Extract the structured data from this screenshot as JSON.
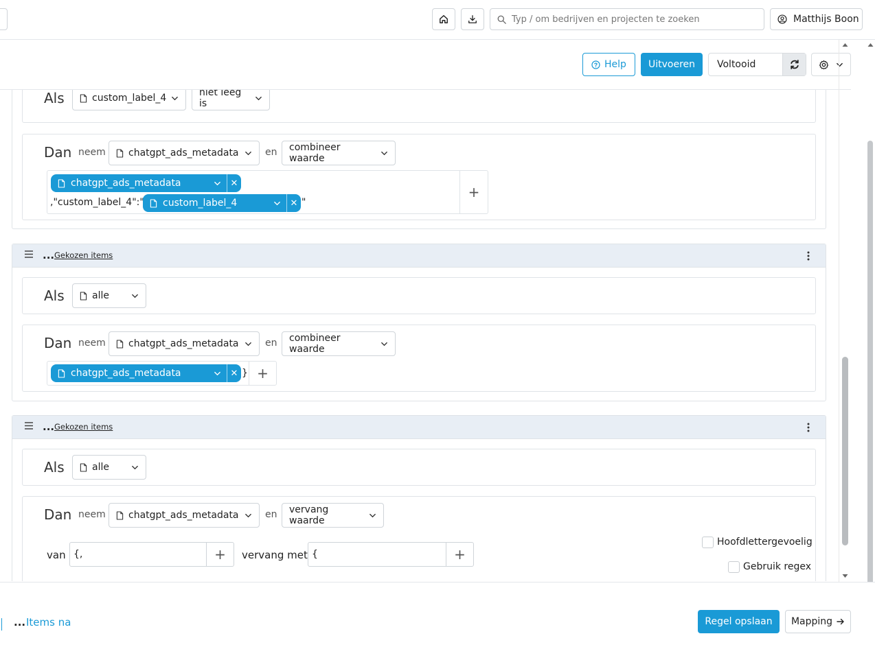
{
  "header": {
    "search_placeholder": "Typ / om bedrijven en projecten te zoeken",
    "user_name": "Matthijs Boon"
  },
  "actions": {
    "help_label": "Help",
    "run_label": "Uitvoeren",
    "status_value": "Voltooid"
  },
  "rule1": {
    "if_label": "Als",
    "field": "custom_label_4",
    "condition": "niet leeg is",
    "then_label": "Dan",
    "take_label": "neem",
    "target": "chatgpt_ads_metadata",
    "and_label": "en",
    "operation": "combineer waarde",
    "chip1": "chatgpt_ads_metadata",
    "text_before": ",\"custom_label_4\":\"",
    "chip2": "custom_label_4",
    "text_after": "\""
  },
  "rule2": {
    "ellipsis": "...",
    "header_link": "Gekozen items",
    "if_label": "Als",
    "field": "alle",
    "then_label": "Dan",
    "take_label": "neem",
    "target": "chatgpt_ads_metadata",
    "and_label": "en",
    "operation": "combineer waarde",
    "chip1": "chatgpt_ads_metadata",
    "text_after": "}"
  },
  "rule3": {
    "ellipsis": "...",
    "header_link": "Gekozen items",
    "if_label": "Als",
    "field": "alle",
    "then_label": "Dan",
    "take_label": "neem",
    "target": "chatgpt_ads_metadata",
    "and_label": "en",
    "operation": "vervang waarde",
    "from_label": "van",
    "from_value": "{,",
    "replace_label": "vervang met",
    "replace_value": "{",
    "case_label": "Hoofdlettergevoelig",
    "regex_label": "Gebruik regex"
  },
  "footer": {
    "ellipsis": "...",
    "items_after": "Items na",
    "save_label": "Regel opslaan",
    "mapping_label": "Mapping"
  },
  "colors": {
    "accent": "#1a9ad6",
    "header_bg": "#e8eef5"
  }
}
